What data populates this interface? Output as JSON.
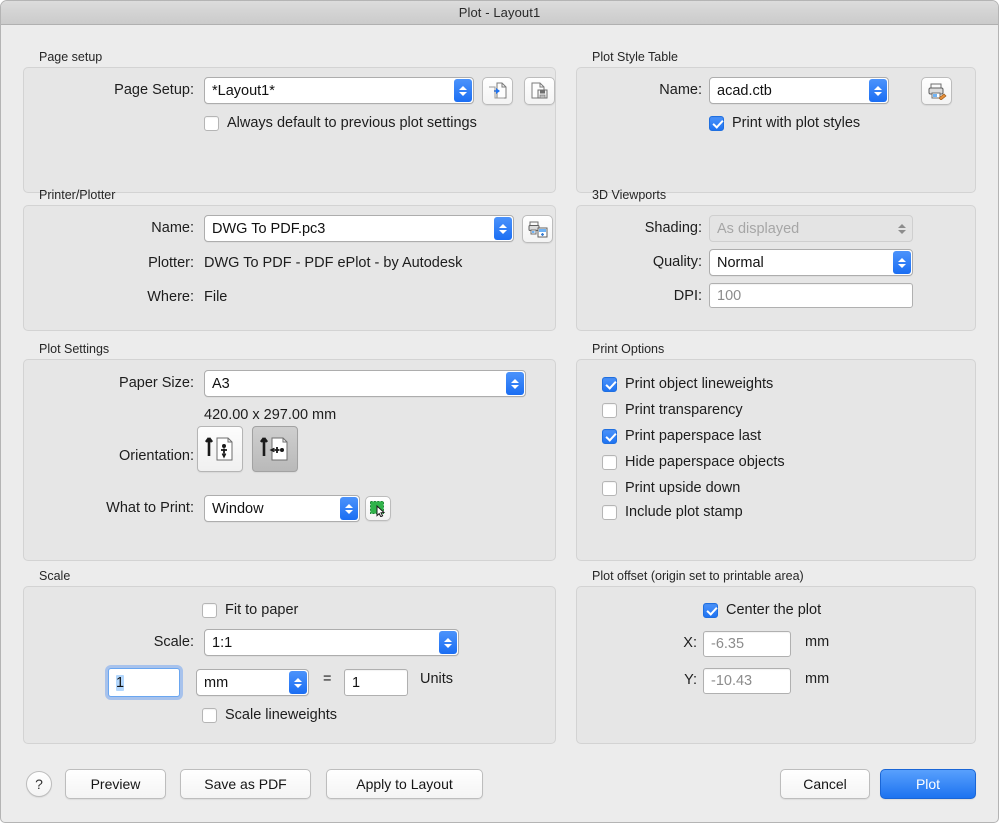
{
  "window": {
    "title": "Plot - Layout1"
  },
  "page_setup": {
    "group_title": "Page setup",
    "name_label": "Page Setup:",
    "name_value": "*Layout1*",
    "import_icon": "import-page-setup-icon",
    "save_icon": "save-page-setup-icon",
    "always_default_label": "Always default to previous plot settings",
    "always_default_checked": false
  },
  "plot_style_table": {
    "group_title": "Plot Style Table",
    "name_label": "Name:",
    "name_value": "acad.ctb",
    "edit_icon": "printer-edit-icon",
    "print_with_plot_styles_label": "Print with plot styles",
    "print_with_plot_styles_checked": true
  },
  "printer_plotter": {
    "group_title": "Printer/Plotter",
    "name_label": "Name:",
    "name_value": "DWG To PDF.pc3",
    "properties_icon": "printer-properties-icon",
    "plotter_label": "Plotter:",
    "plotter_value": "DWG To PDF - PDF ePlot - by Autodesk",
    "where_label": "Where:",
    "where_value": "File"
  },
  "viewports_3d": {
    "group_title": "3D Viewports",
    "shading_label": "Shading:",
    "shading_value": "As displayed",
    "shading_enabled": false,
    "quality_label": "Quality:",
    "quality_value": "Normal",
    "dpi_label": "DPI:",
    "dpi_value": "100",
    "dpi_enabled": false
  },
  "plot_settings": {
    "group_title": "Plot Settings",
    "paper_size_label": "Paper Size:",
    "paper_size_value": "A3",
    "paper_dimensions": "420.00 x 297.00 mm",
    "orientation_label": "Orientation:",
    "orientation_portrait_icon": "portrait-orientation-icon",
    "orientation_landscape_icon": "landscape-orientation-icon",
    "orientation_selected": "landscape",
    "what_to_print_label": "What to Print:",
    "what_to_print_value": "Window",
    "pick_window_icon": "pick-window-icon"
  },
  "print_options": {
    "group_title": "Print Options",
    "items": [
      {
        "label": "Print object lineweights",
        "checked": true
      },
      {
        "label": "Print transparency",
        "checked": false
      },
      {
        "label": "Print paperspace last",
        "checked": true
      },
      {
        "label": "Hide paperspace objects",
        "checked": false
      },
      {
        "label": "Print upside down",
        "checked": false
      },
      {
        "label": "Include plot stamp",
        "checked": false
      }
    ]
  },
  "scale": {
    "group_title": "Scale",
    "fit_to_paper_label": "Fit to paper",
    "fit_to_paper_checked": false,
    "scale_label": "Scale:",
    "scale_value": "1:1",
    "numerator_value": "1",
    "unit_value": "mm",
    "equals_sign": "=",
    "denominator_value": "1",
    "units_label": "Units",
    "scale_lineweights_label": "Scale lineweights",
    "scale_lineweights_checked": false
  },
  "plot_offset": {
    "group_title": "Plot offset (origin set to printable area)",
    "center_the_plot_label": "Center the plot",
    "center_the_plot_checked": true,
    "x_label": "X:",
    "x_value": "-6.35",
    "x_unit": "mm",
    "y_label": "Y:",
    "y_value": "-10.43",
    "y_unit": "mm"
  },
  "buttons": {
    "help": "?",
    "preview": "Preview",
    "save_as_pdf": "Save as PDF",
    "apply_to_layout": "Apply to Layout",
    "cancel": "Cancel",
    "plot": "Plot"
  },
  "colors": {
    "accent_blue": "#1d73f0",
    "window_bg": "#ececec",
    "group_bg": "#e6e6e6",
    "pick_window_green": "#2fb34a"
  }
}
